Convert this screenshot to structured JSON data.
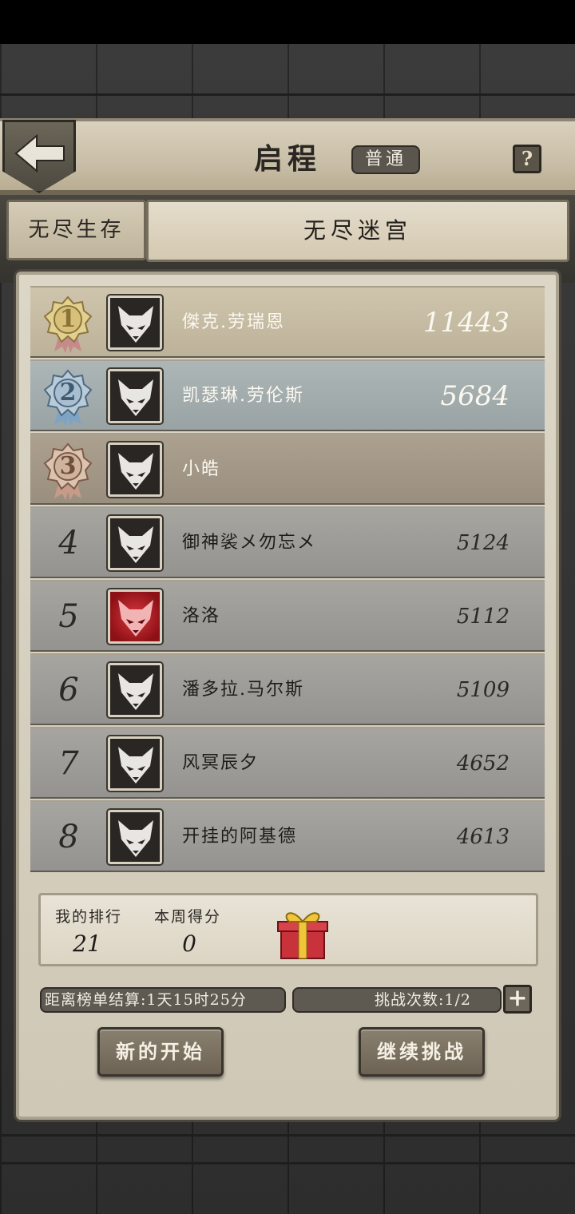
{
  "header": {
    "title": "启程",
    "mode": "普通",
    "help": "?"
  },
  "tabs": {
    "left": "无尽生存",
    "right": "无尽迷宫"
  },
  "leaderboard": [
    {
      "rank": "1",
      "name": "傑克.劳瑞恩",
      "score": "11443"
    },
    {
      "rank": "2",
      "name": "凯瑟琳.劳伦斯",
      "score": "5684"
    },
    {
      "rank": "3",
      "name": "小皓",
      "score": ""
    },
    {
      "rank": "4",
      "name": "御神裟メ勿忘メ",
      "score": "5124"
    },
    {
      "rank": "5",
      "name": "洛洛",
      "score": "5112"
    },
    {
      "rank": "6",
      "name": "潘多拉.马尔斯",
      "score": "5109"
    },
    {
      "rank": "7",
      "name": "风冥辰夕",
      "score": "4652"
    },
    {
      "rank": "8",
      "name": "开挂的阿基德",
      "score": "4613"
    }
  ],
  "my": {
    "rank_label": "我的排行",
    "rank_value": "21",
    "score_label": "本周得分",
    "score_value": "0"
  },
  "footer": {
    "settle_text": "距离榜单结算:1天15时25分",
    "challenge_text": "挑战次数:1/2",
    "plus": "+",
    "new_start": "新的开始",
    "continue": "继续挑战"
  }
}
